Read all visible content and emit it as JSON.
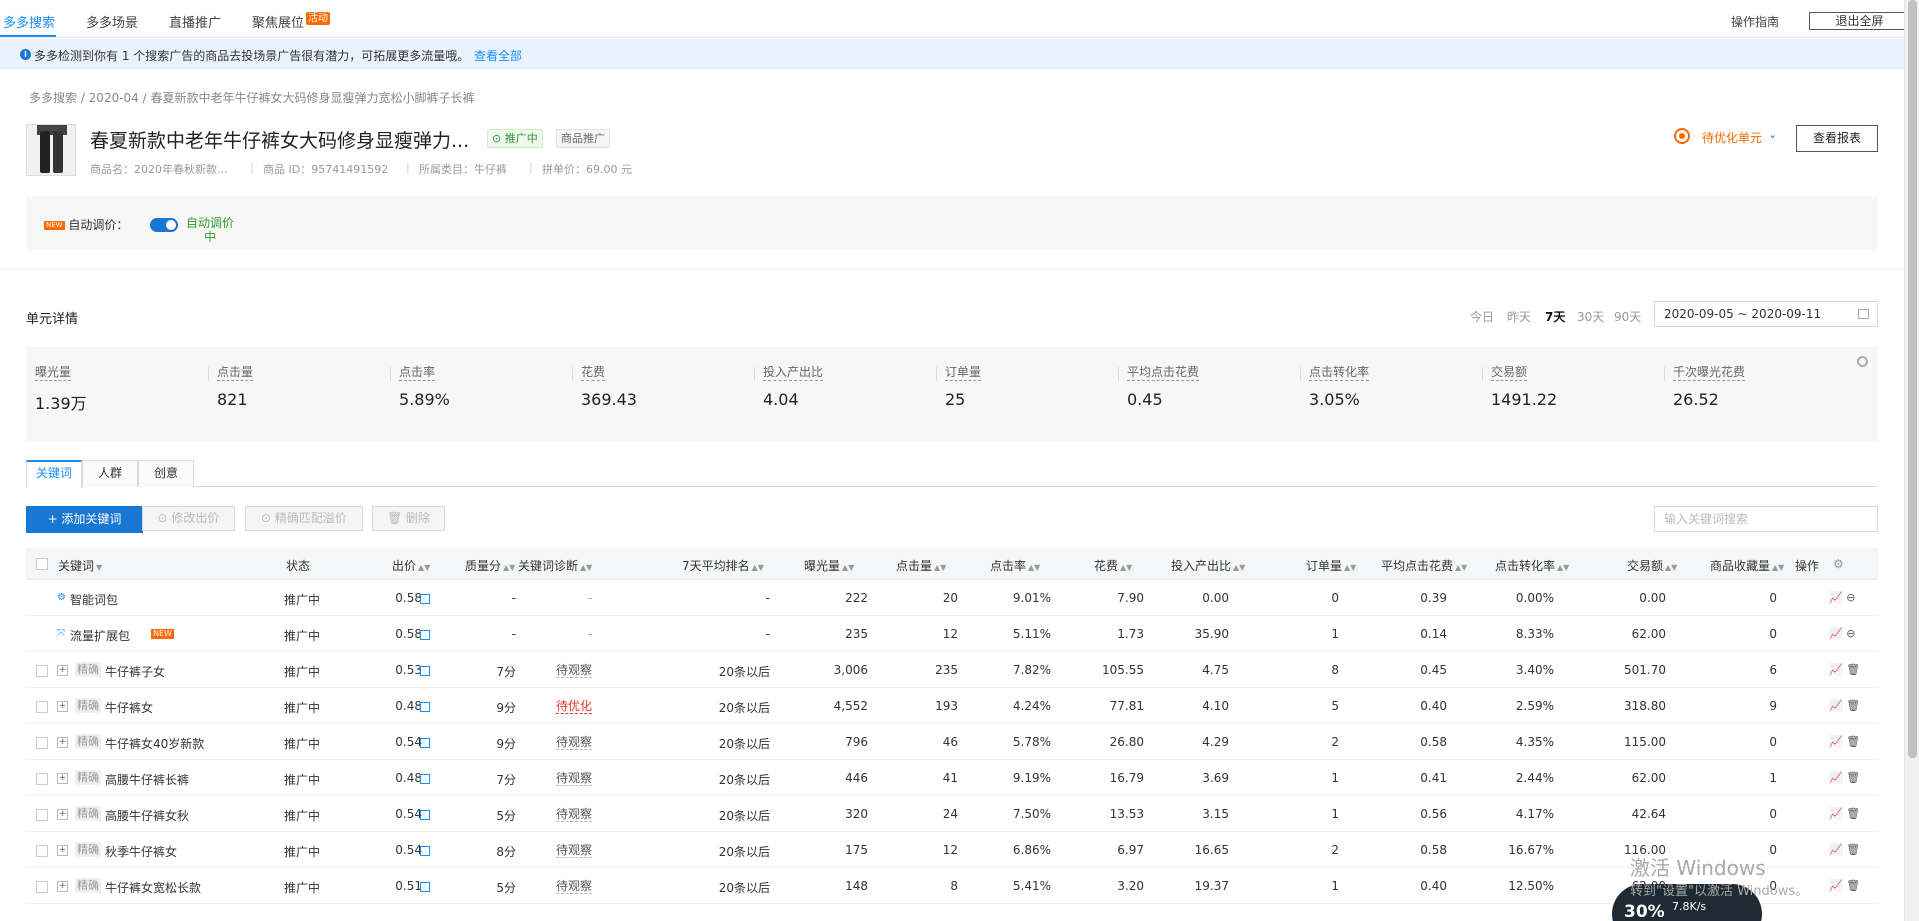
{
  "topnav": {
    "tabs": [
      "多多搜索",
      "多多场景",
      "直播推广",
      "聚焦展位"
    ],
    "hot_badge": "活动",
    "guide": "操作指南",
    "exit": "退出全屏"
  },
  "notice": {
    "text": "多多检测到你有 1 个搜索广告的商品去投场景广告很有潜力，可拓展更多流量哦。",
    "link": "查看全部"
  },
  "breadcrumb": "多多搜索 / 2020-04 / 春夏新款中老年牛仔裤女大码修身显瘦弹力宽松小脚裤子长裤",
  "product": {
    "title": "春夏新款中老年牛仔裤女大码修身显瘦弹力...",
    "status_tag": "推广中",
    "type_tag": "商品推广",
    "meta": [
      "商品名：2020年春秋新款...",
      "商品 ID：95741491592",
      "所属类目：牛仔裤",
      "拼单价：69.00 元"
    ],
    "optimize_label": "待优化单元",
    "report_button": "查看报表"
  },
  "auto_price": {
    "new_badge": "NEW",
    "label": "自动调价：",
    "status": "自动调价中",
    "enabled": true
  },
  "unit": {
    "title": "单元详情",
    "ranges": [
      "今日",
      "昨天",
      "7天",
      "30天",
      "90天"
    ],
    "active_range": "7天",
    "date_range": "2020-09-05 ~ 2020-09-11",
    "metrics": [
      {
        "label": "曝光量",
        "value": "1.39万"
      },
      {
        "label": "点击量",
        "value": "821"
      },
      {
        "label": "点击率",
        "value": "5.89%"
      },
      {
        "label": "花费",
        "value": "369.43"
      },
      {
        "label": "投入产出比",
        "value": "4.04"
      },
      {
        "label": "订单量",
        "value": "25"
      },
      {
        "label": "平均点击花费",
        "value": "0.45"
      },
      {
        "label": "点击转化率",
        "value": "3.05%"
      },
      {
        "label": "交易额",
        "value": "1491.22"
      },
      {
        "label": "千次曝光花费",
        "value": "26.52"
      }
    ]
  },
  "tabs": [
    "关键词",
    "人群",
    "创意"
  ],
  "toolbar": {
    "add": "+ 添加关键词",
    "modify": "修改出价",
    "match": "精确匹配溢价",
    "delete": "删除",
    "search_placeholder": "输入关键词搜索"
  },
  "table": {
    "headers": [
      "关键词",
      "状态",
      "出价",
      "质量分",
      "关键词诊断",
      "7天平均排名",
      "曝光量",
      "点击量",
      "点击率",
      "花费",
      "投入产出比",
      "订单量",
      "平均点击花费",
      "点击转化率",
      "交易额",
      "商品收藏量",
      "操作"
    ],
    "match_tag": "精确",
    "new_tag": "NEW",
    "rows": [
      {
        "kw": "智能词包",
        "kind": "pack",
        "status": "推广中",
        "bid": "0.58",
        "qs": "-",
        "diag": "-",
        "rank": "-",
        "imp": "222",
        "clk": "20",
        "ctr": "9.01%",
        "cost": "7.90",
        "roi": "0.00",
        "ord": "0",
        "cpc": "0.39",
        "cvr": "0.00%",
        "gmv": "0.00",
        "fav": "0"
      },
      {
        "kw": "流量扩展包",
        "kind": "expand",
        "status": "推广中",
        "bid": "0.58",
        "qs": "-",
        "diag": "-",
        "rank": "-",
        "imp": "235",
        "clk": "12",
        "ctr": "5.11%",
        "cost": "1.73",
        "roi": "35.90",
        "ord": "1",
        "cpc": "0.14",
        "cvr": "8.33%",
        "gmv": "62.00",
        "fav": "0"
      },
      {
        "kw": "牛仔裤子女",
        "kind": "kw",
        "status": "推广中",
        "bid": "0.53",
        "qs": "7分",
        "diag": "待观察",
        "rank": "20条以后",
        "imp": "3,006",
        "clk": "235",
        "ctr": "7.82%",
        "cost": "105.55",
        "roi": "4.75",
        "ord": "8",
        "cpc": "0.45",
        "cvr": "3.40%",
        "gmv": "501.70",
        "fav": "6"
      },
      {
        "kw": "牛仔裤女",
        "kind": "kw",
        "status": "推广中",
        "bid": "0.48",
        "qs": "9分",
        "diag": "待优化",
        "rank": "20条以后",
        "imp": "4,552",
        "clk": "193",
        "ctr": "4.24%",
        "cost": "77.81",
        "roi": "4.10",
        "ord": "5",
        "cpc": "0.40",
        "cvr": "2.59%",
        "gmv": "318.80",
        "fav": "9"
      },
      {
        "kw": "牛仔裤女40岁新款",
        "kind": "kw",
        "status": "推广中",
        "bid": "0.54",
        "qs": "9分",
        "diag": "待观察",
        "rank": "20条以后",
        "imp": "796",
        "clk": "46",
        "ctr": "5.78%",
        "cost": "26.80",
        "roi": "4.29",
        "ord": "2",
        "cpc": "0.58",
        "cvr": "4.35%",
        "gmv": "115.00",
        "fav": "0"
      },
      {
        "kw": "高腰牛仔裤长裤",
        "kind": "kw",
        "status": "推广中",
        "bid": "0.48",
        "qs": "7分",
        "diag": "待观察",
        "rank": "20条以后",
        "imp": "446",
        "clk": "41",
        "ctr": "9.19%",
        "cost": "16.79",
        "roi": "3.69",
        "ord": "1",
        "cpc": "0.41",
        "cvr": "2.44%",
        "gmv": "62.00",
        "fav": "1"
      },
      {
        "kw": "高腰牛仔裤女秋",
        "kind": "kw",
        "status": "推广中",
        "bid": "0.54",
        "qs": "5分",
        "diag": "待观察",
        "rank": "20条以后",
        "imp": "320",
        "clk": "24",
        "ctr": "7.50%",
        "cost": "13.53",
        "roi": "3.15",
        "ord": "1",
        "cpc": "0.56",
        "cvr": "4.17%",
        "gmv": "42.64",
        "fav": "0"
      },
      {
        "kw": "秋季牛仔裤女",
        "kind": "kw",
        "status": "推广中",
        "bid": "0.54",
        "qs": "8分",
        "diag": "待观察",
        "rank": "20条以后",
        "imp": "175",
        "clk": "12",
        "ctr": "6.86%",
        "cost": "6.97",
        "roi": "16.65",
        "ord": "2",
        "cpc": "0.58",
        "cvr": "16.67%",
        "gmv": "116.00",
        "fav": "0"
      },
      {
        "kw": "牛仔裤女宽松长款",
        "kind": "kw",
        "status": "推广中",
        "bid": "0.51",
        "qs": "5分",
        "diag": "待观察",
        "rank": "20条以后",
        "imp": "148",
        "clk": "8",
        "ctr": "5.41%",
        "cost": "3.20",
        "roi": "19.37",
        "ord": "1",
        "cpc": "0.40",
        "cvr": "12.50%",
        "gmv": "62.00",
        "fav": "0"
      }
    ]
  },
  "overlay": {
    "watermark_title": "激活 Windows",
    "watermark_sub": "转到\"设置\"以激活 Windows。",
    "percent": "30%",
    "speed": "7.8K/s"
  }
}
